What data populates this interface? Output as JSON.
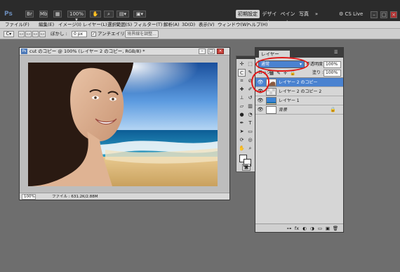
{
  "app": {
    "logo": "Ps"
  },
  "appbar": {
    "zoom": "100%",
    "workspaces": [
      "初期設定",
      "デザイン",
      "ペイント",
      "写真"
    ],
    "more": "»",
    "cslive": "CS Live"
  },
  "menu": [
    "ファイル(F)",
    "編集(E)",
    "イメージ(I)",
    "レイヤー(L)",
    "選択範囲(S)",
    "フィルター(T)",
    "解析(A)",
    "3D(D)",
    "表示(V)",
    "ウィンドウ(W)",
    "ヘルプ(H)"
  ],
  "options": {
    "feather_label": "ぼかし :",
    "feather_value": "0 px",
    "antialias_label": "アンチエイリアス",
    "refine_button": "境界線を調整..."
  },
  "document": {
    "title": "cut のコピー @ 100% (レイヤー 2 のコピー, RGB/8) *",
    "zoom": "100%",
    "file_info": "ファイル : 631.2K/2.88M"
  },
  "layers": {
    "tab": "レイヤー",
    "blend_mode": "通常",
    "opacity_label": "不透明度 :",
    "opacity": "100%",
    "lock_label": "ロック :",
    "lock_icons": "▦ ✎ ✛ 🔒",
    "fill_label": "塗り :",
    "fill": "100%",
    "rows": [
      {
        "name": "レイヤー 2 のコピー",
        "selected": true
      },
      {
        "name": "レイヤー 2 のコピー 2",
        "selected": false
      },
      {
        "name": "レイヤー 1",
        "selected": false
      },
      {
        "name": "背景",
        "selected": false,
        "locked": true
      }
    ],
    "footer_icons": [
      "⊶",
      "fx",
      "◐",
      "◑",
      "▭",
      "▣",
      "🗑"
    ]
  },
  "colors": {
    "annotation": "#e01818",
    "selection": "#4a82d0"
  }
}
